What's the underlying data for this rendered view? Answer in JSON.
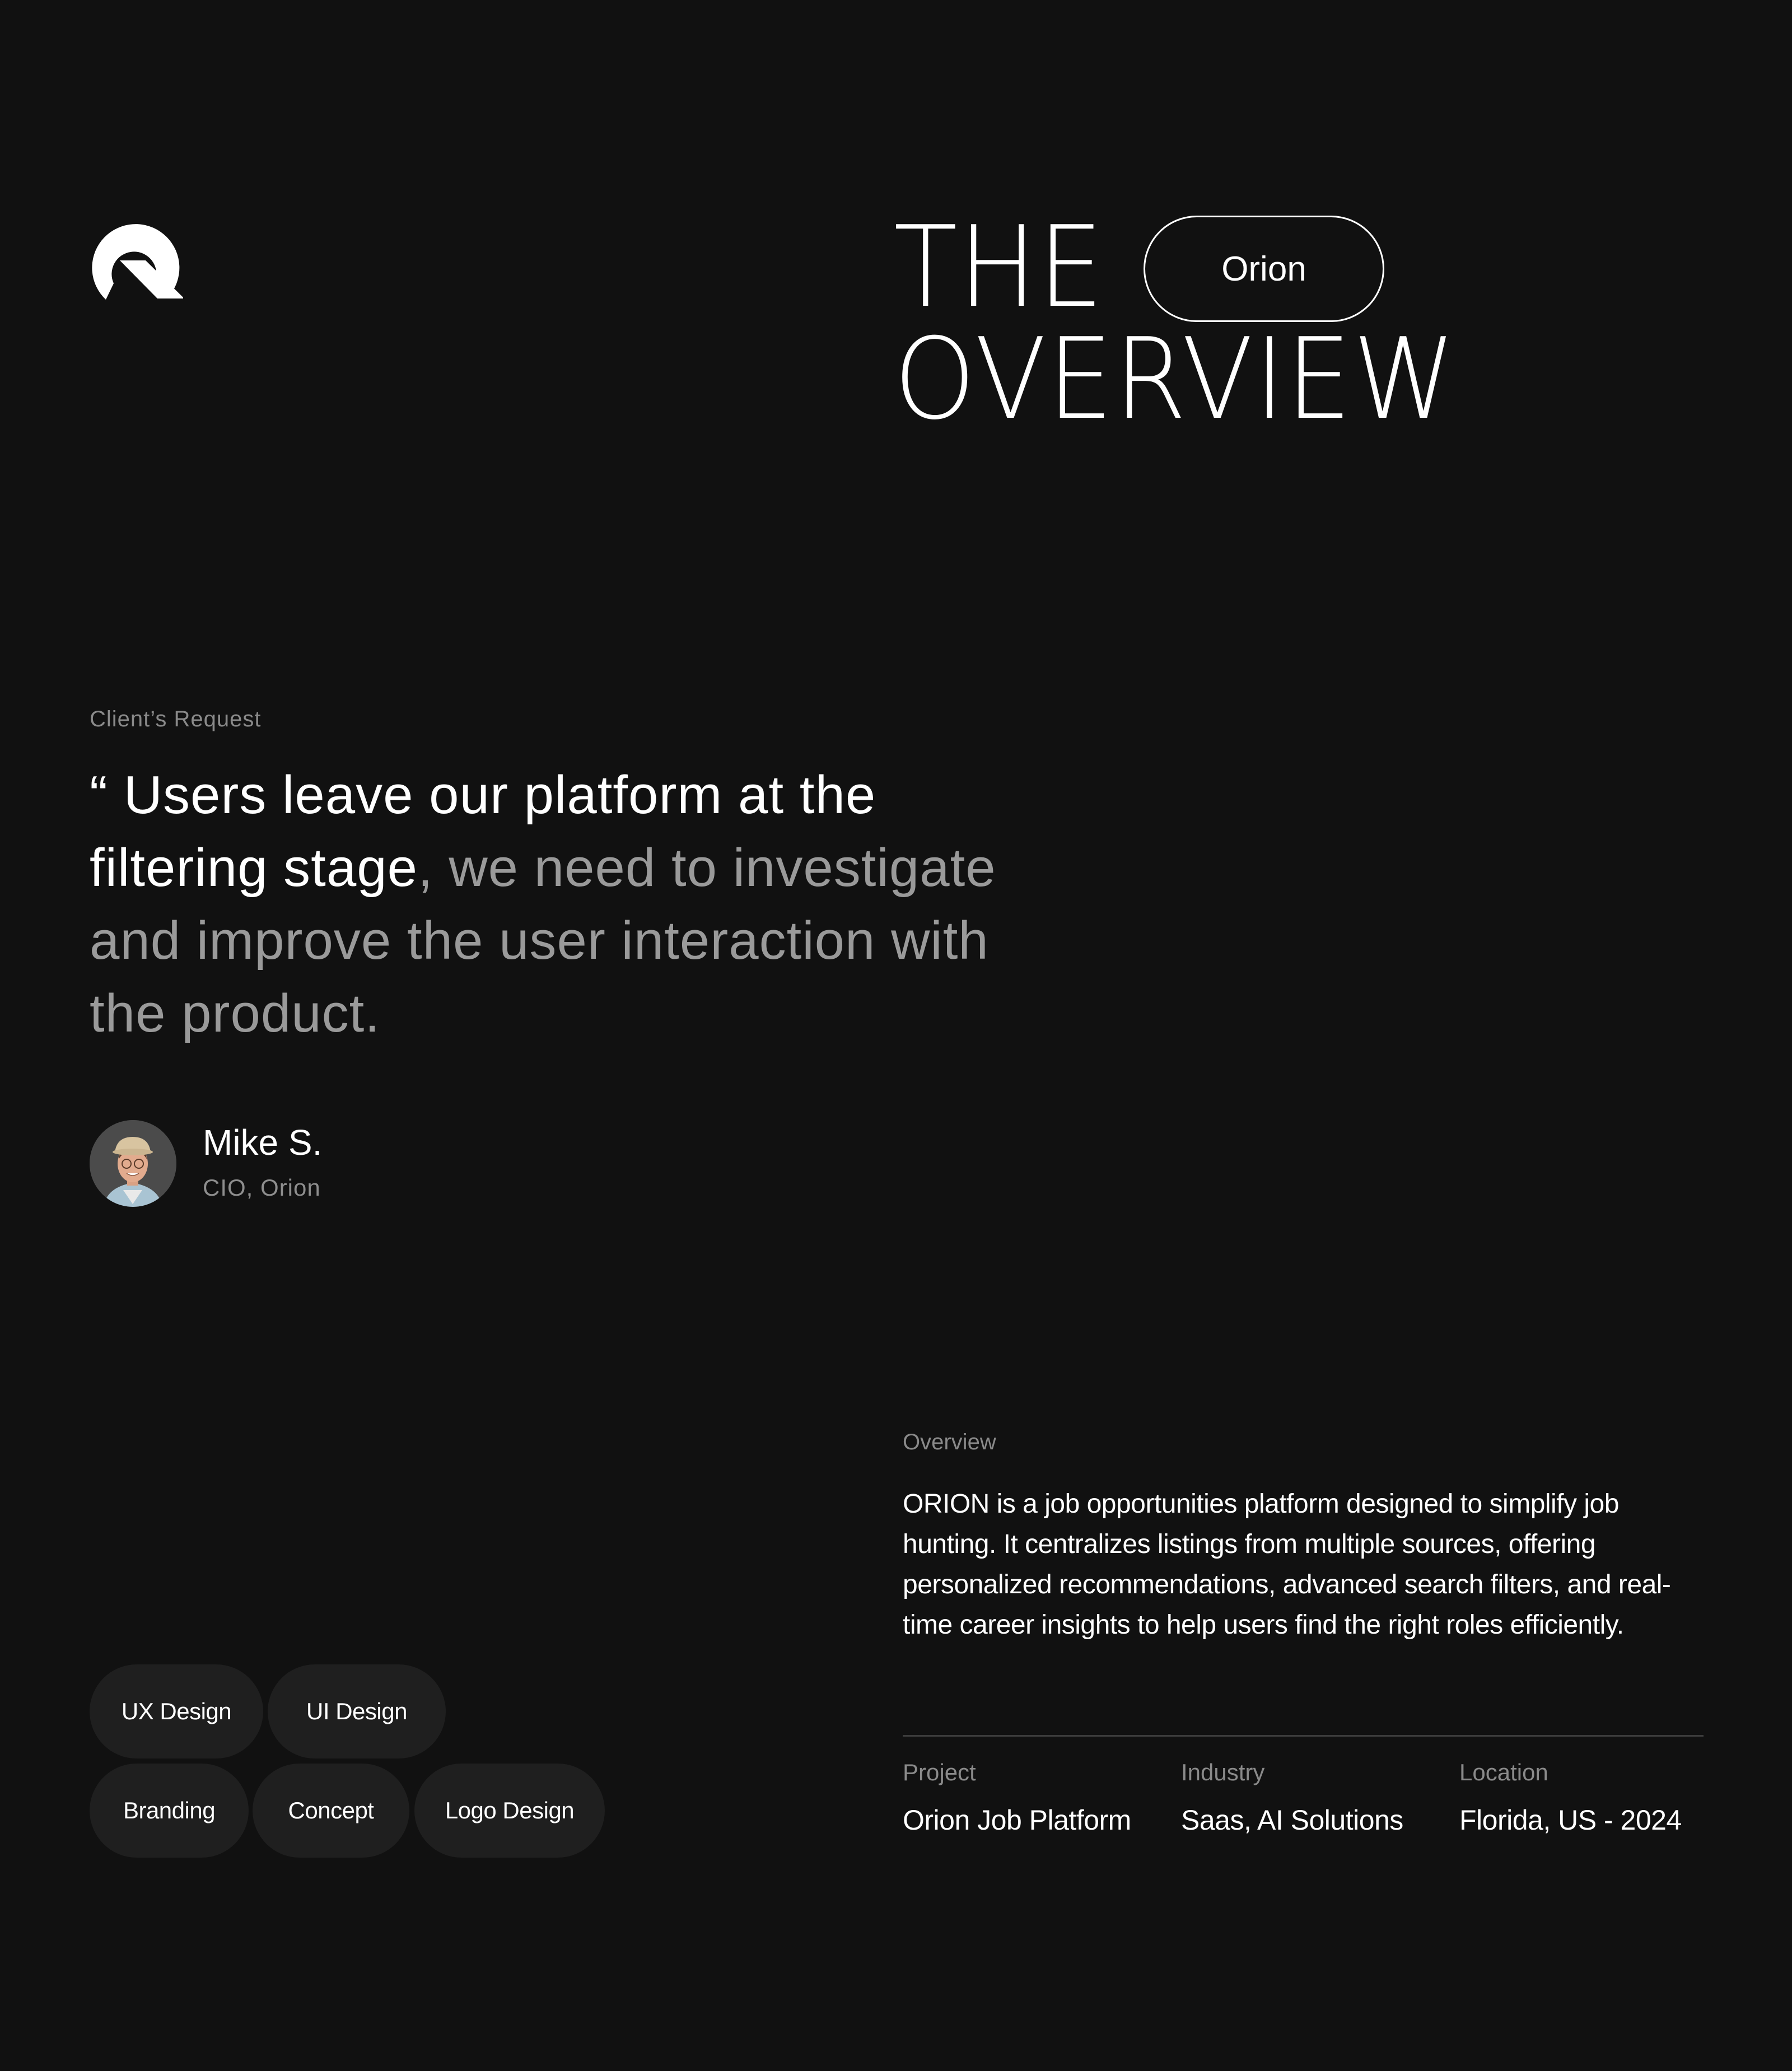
{
  "brand": {
    "logo_icon": "q-logo-icon"
  },
  "hero": {
    "title_line1": "THE",
    "title_line2": "OVERVIEW",
    "pill_label": "Orion"
  },
  "client_request": {
    "label": "Client’s Request",
    "quote_open": "“ ",
    "quote_highlight": "Users leave our platform at the filtering stage",
    "quote_rest": ", we need to investigate and improve the user interaction with the product."
  },
  "person": {
    "name": "Mike S.",
    "role": "CIO, Orion",
    "avatar_icon": "avatar-photo"
  },
  "tags": [
    "UX Design",
    "UI Design",
    "Branding",
    "Concept",
    "Logo Design"
  ],
  "overview": {
    "label": "Overview",
    "text": "ORION is a job opportunities platform designed to simplify job hunting. It centralizes listings from multiple sources, offering personalized recommendations, advanced search filters, and real-time career insights to help users find the right roles efficiently."
  },
  "meta": {
    "project": {
      "label": "Project",
      "value": "Orion Job Platform"
    },
    "industry": {
      "label": "Industry",
      "value": "Saas, AI Solutions"
    },
    "location": {
      "label": "Location",
      "value": "Florida, US - 2024"
    }
  }
}
